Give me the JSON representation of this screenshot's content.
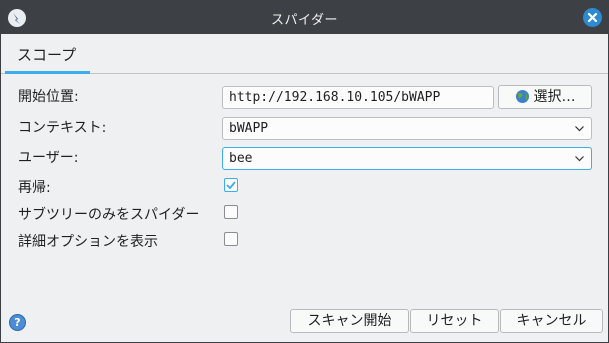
{
  "window": {
    "title": "スパイダー"
  },
  "tabs": [
    {
      "label": "スコープ"
    }
  ],
  "form": {
    "start_point_label": "開始位置:",
    "start_point_value": "http://192.168.10.105/bWAPP",
    "select_button": "選択…",
    "context_label": "コンテキスト:",
    "context_value": "bWAPP",
    "user_label": "ユーザー:",
    "user_value": "bee",
    "recurse_label": "再帰:",
    "recurse_checked": true,
    "subtree_only_label": "サブツリーのみをスパイダー",
    "subtree_only_checked": false,
    "show_advanced_label": "詳細オプションを表示",
    "show_advanced_checked": false
  },
  "buttons": {
    "start_scan": "スキャン開始",
    "reset": "リセット",
    "cancel": "キャンセル"
  },
  "colors": {
    "accent": "#3daee9",
    "titlebar": "#3d4045",
    "close": "#2f8bd1"
  }
}
